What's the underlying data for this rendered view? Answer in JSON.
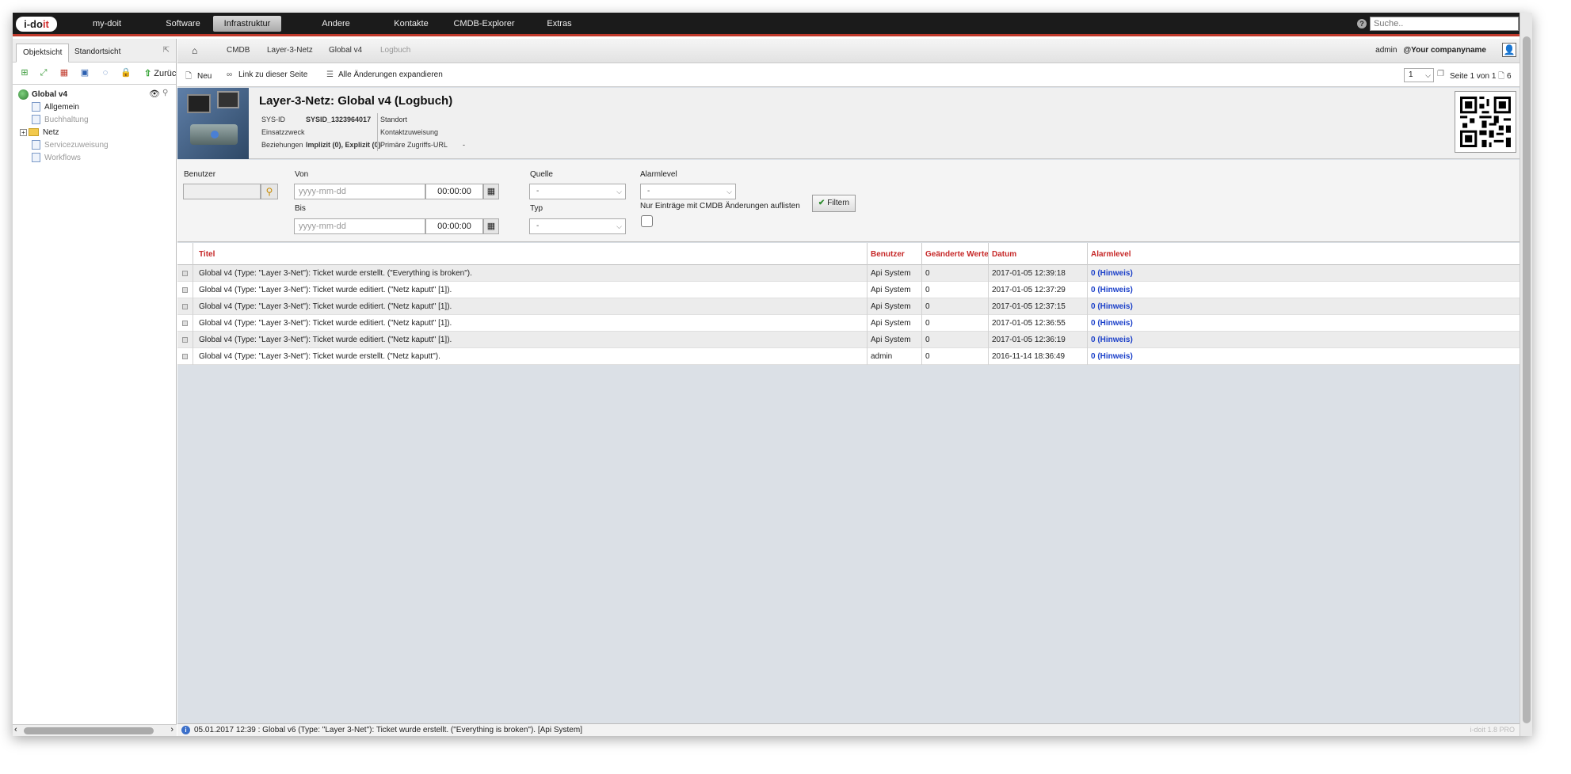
{
  "topbar": {
    "logo_main": "i-do",
    "logo_accent": "it",
    "nav": [
      {
        "label": "my-doit"
      },
      {
        "label": "Software"
      },
      {
        "label": "Infrastruktur"
      },
      {
        "label": "Andere"
      },
      {
        "label": "Kontakte"
      },
      {
        "label": "CMDB-Explorer"
      },
      {
        "label": "Extras"
      }
    ],
    "active_nav": "Infrastruktur",
    "help": "?",
    "search_placeholder": "Suche.."
  },
  "left": {
    "tabs": [
      {
        "label": "Objektsicht"
      },
      {
        "label": "Standortsicht"
      }
    ],
    "back_label": "Zurüc",
    "tree": [
      {
        "label": "Global v4"
      },
      {
        "label": "Allgemein"
      },
      {
        "label": "Buchhaltung"
      },
      {
        "label": "Netz"
      },
      {
        "label": "Servicezuweisung"
      },
      {
        "label": "Workflows"
      }
    ]
  },
  "breadcrumb": {
    "items": [
      {
        "label": "CMDB"
      },
      {
        "label": "Layer-3-Netz"
      },
      {
        "label": "Global v4"
      },
      {
        "label": "Logbuch"
      }
    ],
    "user": "admin",
    "company": "@Your companyname"
  },
  "actions": {
    "new": "Neu",
    "link": "Link zu dieser Seite",
    "expand": "Alle Änderungen expandieren",
    "page_select": "1",
    "page_info": "Seite 1 von 1",
    "count": "6"
  },
  "object": {
    "title": "Layer-3-Netz: Global v4 (Logbuch)",
    "sysid_label": "SYS-ID",
    "sysid_value": "SYSID_1323964017",
    "einsatz_label": "Einsatzzweck",
    "bez_label": "Beziehungen",
    "bez_value": "Implizit (0), Explizit (0)",
    "standort_label": "Standort",
    "kontakt_label": "Kontaktzuweisung",
    "url_label": "Primäre Zugriffs-URL",
    "url_value": "-"
  },
  "filter": {
    "benutzer_label": "Benutzer",
    "von_label": "Von",
    "bis_label": "Bis",
    "date_placeholder": "yyyy-mm-dd",
    "time_value": "00:00:00",
    "quelle_label": "Quelle",
    "quelle_value": "-",
    "typ_label": "Typ",
    "typ_value": "-",
    "alarm_label": "Alarmlevel",
    "alarm_value": "-",
    "cmdb_only_label": "Nur Einträge mit CMDB Änderungen auflisten",
    "filter_button": "Filtern"
  },
  "table": {
    "headers": {
      "title": "Titel",
      "user": "Benutzer",
      "changed": "Geänderte Werte",
      "date": "Datum",
      "alarm": "Alarmlevel"
    },
    "rows": [
      {
        "title": "Global v4 (Type: \"Layer 3-Net\"): Ticket wurde erstellt. (\"Everything is broken\").",
        "user": "Api System",
        "changed": "0",
        "date": "2017-01-05 12:39:18",
        "alarm": "0 (Hinweis)"
      },
      {
        "title": "Global v4 (Type: \"Layer 3-Net\"): Ticket wurde editiert. (\"Netz kaputt\" [1]).",
        "user": "Api System",
        "changed": "0",
        "date": "2017-01-05 12:37:29",
        "alarm": "0 (Hinweis)"
      },
      {
        "title": "Global v4 (Type: \"Layer 3-Net\"): Ticket wurde editiert. (\"Netz kaputt\" [1]).",
        "user": "Api System",
        "changed": "0",
        "date": "2017-01-05 12:37:15",
        "alarm": "0 (Hinweis)"
      },
      {
        "title": "Global v4 (Type: \"Layer 3-Net\"): Ticket wurde editiert. (\"Netz kaputt\" [1]).",
        "user": "Api System",
        "changed": "0",
        "date": "2017-01-05 12:36:55",
        "alarm": "0 (Hinweis)"
      },
      {
        "title": "Global v4 (Type: \"Layer 3-Net\"): Ticket wurde editiert. (\"Netz kaputt\" [1]).",
        "user": "Api System",
        "changed": "0",
        "date": "2017-01-05 12:36:19",
        "alarm": "0 (Hinweis)"
      },
      {
        "title": "Global v4 (Type: \"Layer 3-Net\"): Ticket wurde erstellt. (\"Netz kaputt\").",
        "user": "admin",
        "changed": "0",
        "date": "2016-11-14 18:36:49",
        "alarm": "0 (Hinweis)"
      }
    ]
  },
  "status": {
    "message": "05.01.2017 12:39 : Global v6 (Type: \"Layer 3-Net\"): Ticket wurde erstellt. (\"Everything is broken\"). [Api System]",
    "version": "i-doit 1.8 PRO"
  },
  "colors": {
    "accent_red": "#c62828",
    "alarm_blue": "#1a3fc9",
    "topbar": "#1b1b1b"
  }
}
